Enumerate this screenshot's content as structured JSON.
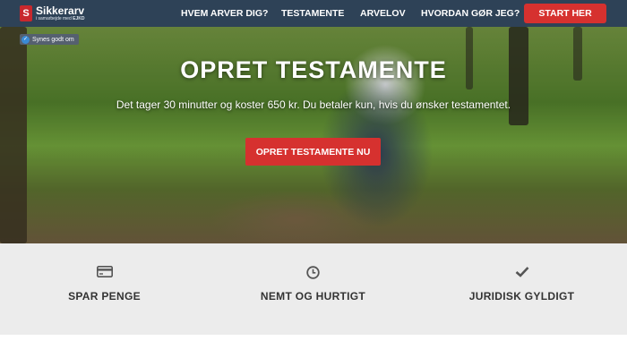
{
  "brand": {
    "name": "Sikkerarv",
    "tagline": "i samarbejde med",
    "partner": "EJKD",
    "mark": "S",
    "color": "#c8282d"
  },
  "nav": {
    "items": [
      {
        "label": "HVEM ARVER DIG?"
      },
      {
        "label": "TESTAMENTE"
      },
      {
        "label": "ARVELOV"
      },
      {
        "label": "HVORDAN GØR JEG?"
      }
    ],
    "cta_label": "START HER"
  },
  "badge": {
    "label": "Synes godt om",
    "icon": "check-icon"
  },
  "hero": {
    "title": "OPRET TESTAMENTE",
    "subtitle": "Det tager 30 minutter og koster 650 kr. Du betaler kun, hvis du ønsker testamentet.",
    "cta_label": "OPRET TESTAMENTE NU"
  },
  "features": [
    {
      "label": "SPAR PENGE",
      "icon": "credit-card-icon"
    },
    {
      "label": "NEMT OG HURTIGT",
      "icon": "clock-icon"
    },
    {
      "label": "JURIDISK GYLDIGT",
      "icon": "checkmark-icon"
    }
  ],
  "colors": {
    "navbar": "#2e4257",
    "accent": "#d6312f",
    "features_bg": "#ececec"
  }
}
